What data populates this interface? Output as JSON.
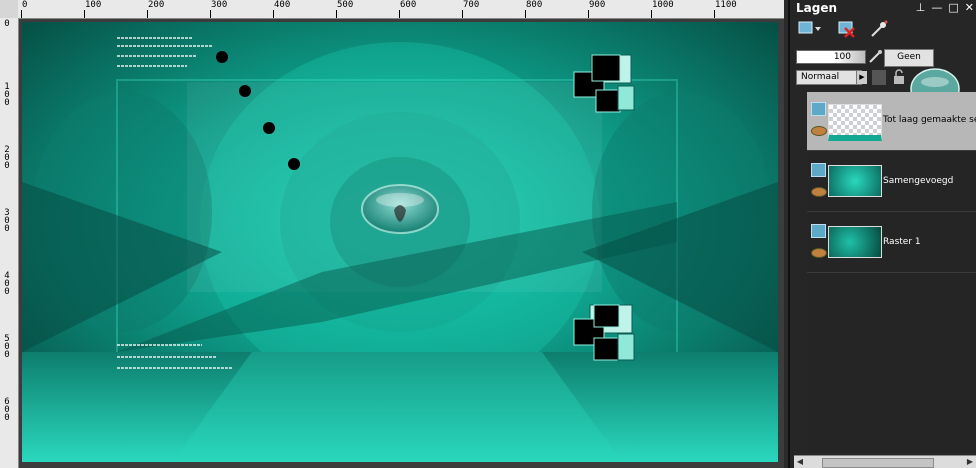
{
  "ruler": {
    "top_labels": [
      "0",
      "100",
      "200",
      "300",
      "400",
      "500",
      "600",
      "700",
      "800",
      "900",
      "1000",
      "1100"
    ],
    "left_labels": [
      "0",
      "100",
      "200",
      "300",
      "400",
      "500",
      "600"
    ]
  },
  "panel": {
    "title": "Lagen",
    "controls": [
      "⊥",
      "—",
      "□",
      "✕"
    ]
  },
  "properties": {
    "opacity": "100",
    "mask_label": "Geen",
    "blend_mode": "Normaal"
  },
  "layers": [
    {
      "name": "Tot laag gemaakte selectie",
      "active": true
    },
    {
      "name": "Samengevoegd",
      "active": false
    },
    {
      "name": "Raster 1",
      "active": false
    }
  ],
  "colors": {
    "accent_teal": "#14b39c",
    "panel_bg": "#262626",
    "active_row": "#b7b7b7"
  }
}
